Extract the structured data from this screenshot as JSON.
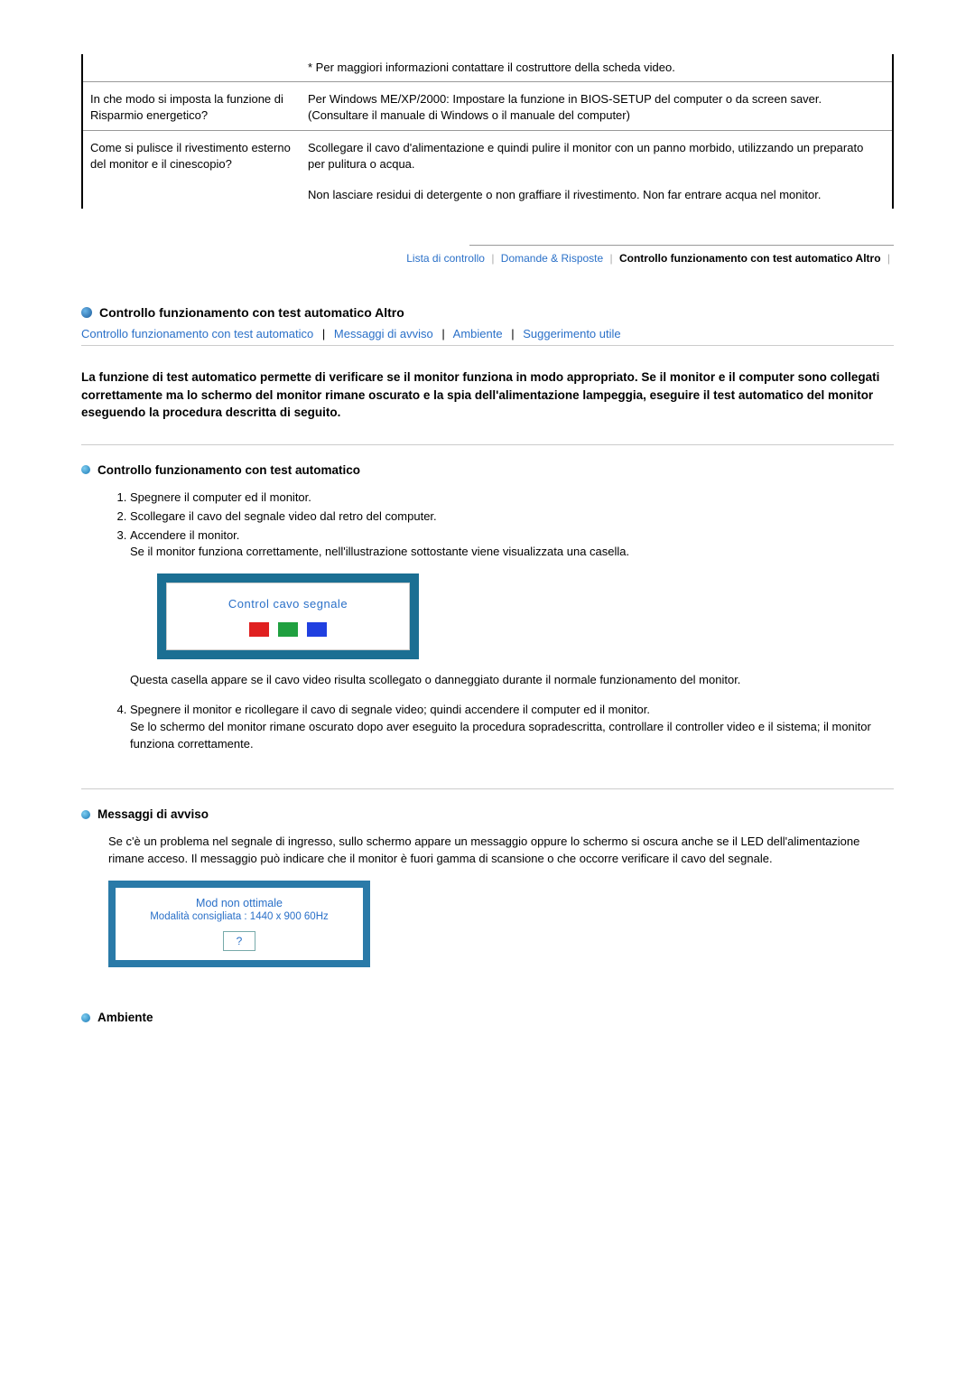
{
  "top_table": {
    "note": "* Per maggiori informazioni contattare il costruttore della scheda video.",
    "rows": [
      {
        "q": "In che modo si imposta la funzione di Risparmio energetico?",
        "a": "Per Windows ME/XP/2000: Impostare la funzione in BIOS-SETUP del computer o da screen saver. (Consultare il manuale di Windows o il manuale del computer)"
      },
      {
        "q": "Come si pulisce il rivestimento esterno del monitor e il cinescopio?",
        "a1": "Scollegare il cavo d'alimentazione e quindi pulire il monitor con un panno morbido, utilizzando un preparato per pulitura o acqua.",
        "a2": "Non lasciare residui di detergente o non graffiare il rivestimento. Non far entrare acqua nel monitor."
      }
    ]
  },
  "nav": {
    "items": [
      "Lista di controllo",
      "Domande & Risposte",
      "Controllo funzionamento con test automatico Altro"
    ],
    "bold_index": 2
  },
  "section_title": "Controllo funzionamento con test automatico Altro",
  "link_row": [
    "Controllo funzionamento con test automatico",
    "Messaggi di avviso",
    "Ambiente",
    "Suggerimento utile"
  ],
  "intro": "La funzione di test automatico permette di verificare se il monitor funziona in modo appropriato. Se il monitor e il computer sono collegati correttamente ma lo schermo del monitor rimane oscurato e la spia dell'alimentazione lampeggia, eseguire il test automatico del monitor eseguendo la procedura descritta di seguito.",
  "subsection1_title": "Controllo funzionamento con test automatico",
  "steps": [
    "Spegnere il computer ed il monitor.",
    "Scollegare il cavo del segnale video dal retro del computer.",
    "Accendere il monitor.",
    "Spegnere il monitor e ricollegare il cavo di segnale video; quindi accendere il computer ed il monitor."
  ],
  "step3_extra": "Se il monitor funziona correttamente, nell'illustrazione sottostante viene visualizzata una casella.",
  "monitor_box_text": "Control cavo segnale",
  "para_after_box": "Questa casella appare se il cavo video risulta scollegato o danneggiato durante il normale funzionamento del monitor.",
  "step4_extra": "Se lo schermo del monitor rimane oscurato dopo aver eseguito la procedura sopradescritta, controllare il controller video e il sistema; il monitor funziona correttamente.",
  "subsection2_title": "Messaggi di avviso",
  "msg_para": "Se c'è un problema nel segnale di ingresso, sullo schermo appare un messaggio oppure lo schermo si oscura anche se il LED dell'alimentazione rimane acceso. Il messaggio può indicare che il monitor è fuori gamma di scansione o che occorre verificare il cavo del segnale.",
  "mode_box": {
    "line1": "Mod non ottimale",
    "line2": "Modalità consigliata :   1440 x 900   60Hz",
    "q": "?"
  },
  "subsection3_title": "Ambiente"
}
